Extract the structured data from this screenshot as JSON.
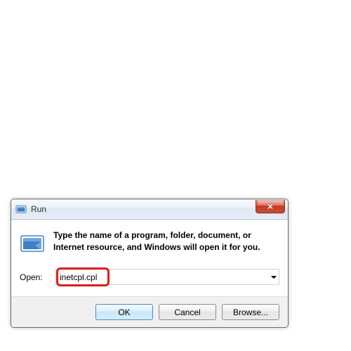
{
  "dialog": {
    "title": "Run",
    "info_text": "Type the name of a program, folder, document, or Internet resource, and Windows will open it for you.",
    "input_label": "Open:",
    "input_value": "inetcpl.cpl",
    "buttons": {
      "ok": "OK",
      "cancel": "Cancel",
      "browse": "Browse..."
    },
    "close_symbol": "✕"
  }
}
